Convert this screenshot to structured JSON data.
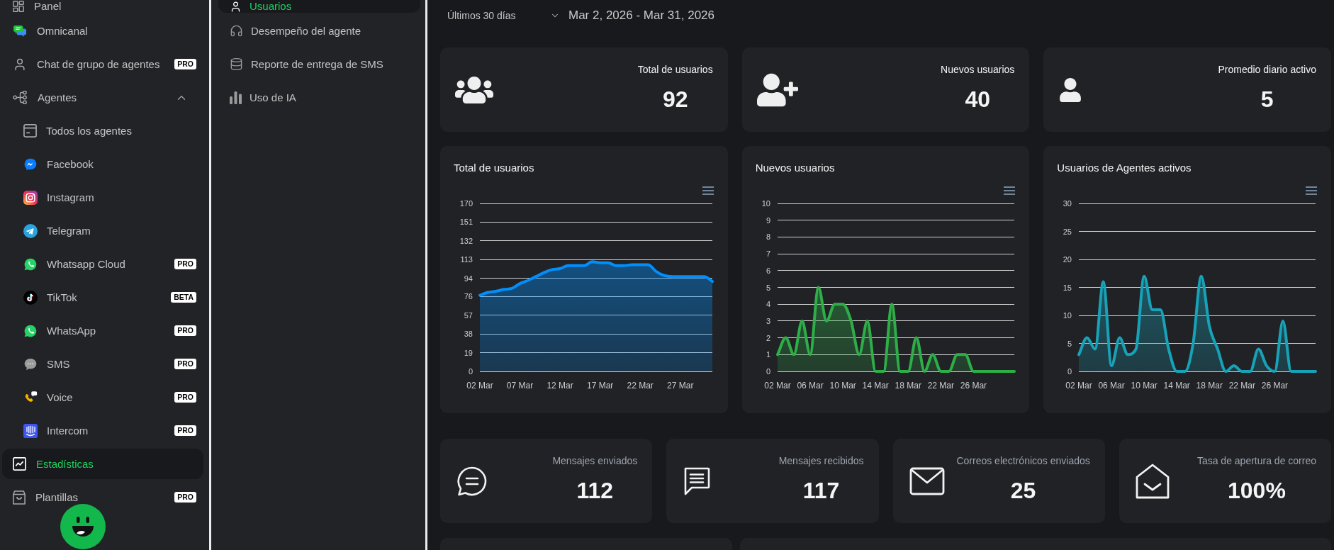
{
  "sidebar": {
    "items": [
      {
        "label": "Panel",
        "selected": false
      },
      {
        "label": "Omnicanal",
        "selected": false
      },
      {
        "label": "Chat de grupo de agentes",
        "badge": "PRO",
        "selected": false
      },
      {
        "label": "Agentes",
        "selected": false,
        "expanded": true,
        "children": [
          {
            "label": "Todos los agentes",
            "selected": false
          },
          {
            "label": "Facebook",
            "selected": false
          },
          {
            "label": "Instagram",
            "selected": false
          },
          {
            "label": "Telegram",
            "selected": false
          },
          {
            "label": "Whatsapp Cloud",
            "badge": "PRO",
            "selected": false
          },
          {
            "label": "TikTok",
            "badge": "BETA",
            "selected": false
          },
          {
            "label": "WhatsApp",
            "badge": "PRO",
            "selected": false
          },
          {
            "label": "SMS",
            "badge": "PRO",
            "selected": false
          },
          {
            "label": "Voice",
            "badge": "PRO",
            "selected": false
          },
          {
            "label": "Intercom",
            "badge": "PRO",
            "selected": false
          }
        ]
      },
      {
        "label": "Estadísticas",
        "selected": true
      },
      {
        "label": "Plantillas",
        "badge": "PRO",
        "selected": false
      }
    ]
  },
  "submenu": {
    "items": [
      {
        "label": "Usuarios",
        "selected": true
      },
      {
        "label": "Desempeño del agente",
        "selected": false
      },
      {
        "label": "Reporte de entrega de SMS",
        "selected": false
      },
      {
        "label": "Uso de IA",
        "selected": false
      }
    ]
  },
  "filter": {
    "range": "Últimos 30 días",
    "dates": "Mar 2, 2026 - Mar 31, 2026"
  },
  "summary_cards": [
    {
      "label": "Total de usuarios",
      "value": "92"
    },
    {
      "label": "Nuevos usuarios",
      "value": "40"
    },
    {
      "label": "Promedio diario activo",
      "value": "5"
    }
  ],
  "charts": [
    {
      "chart_data": {
        "type": "area",
        "title": "Total de usuarios",
        "categories": [
          "02 Mar",
          null,
          null,
          null,
          null,
          "07 Mar",
          null,
          null,
          null,
          null,
          "12 Mar",
          null,
          null,
          null,
          null,
          "17 Mar",
          null,
          null,
          null,
          null,
          "22 Mar",
          null,
          null,
          null,
          null,
          "27 Mar",
          null,
          null,
          null,
          null
        ],
        "series": [
          {
            "color": "#008ffb",
            "values": [
              77,
              80,
              81,
              83,
              84,
              89,
              92,
              96,
              100,
              103,
              104,
              107,
              107,
              107,
              111,
              110,
              110,
              107,
              107,
              108,
              108,
              108,
              101,
              97,
              96,
              96,
              96,
              96,
              96,
              91
            ]
          }
        ],
        "ylim": [
          0,
          170
        ],
        "yticks": [
          0,
          19,
          38,
          57,
          76,
          94,
          113,
          132,
          151,
          170
        ],
        "grid": true
      }
    },
    {
      "chart_data": {
        "type": "area",
        "title": "Nuevos usuarios",
        "categories": [
          "02 Mar",
          null,
          null,
          null,
          "06 Mar",
          null,
          null,
          null,
          "10 Mar",
          null,
          null,
          null,
          "14 Mar",
          null,
          null,
          null,
          "18 Mar",
          null,
          null,
          null,
          "22 Mar",
          null,
          null,
          null,
          "26 Mar",
          null,
          null,
          null,
          null,
          null
        ],
        "series": [
          {
            "color": "#2eae47",
            "values": [
              1,
              2,
              1,
              3,
              1,
              5,
              3,
              4,
              4,
              3,
              1,
              3,
              0,
              0,
              4,
              0,
              0,
              2,
              0,
              1,
              0,
              0,
              1,
              1,
              0,
              0,
              0,
              0,
              0,
              0
            ]
          }
        ],
        "ylim": [
          0,
          10
        ],
        "yticks": [
          0,
          1,
          2,
          3,
          4,
          5,
          6,
          7,
          8,
          9,
          10
        ],
        "grid": true
      }
    },
    {
      "chart_data": {
        "type": "area",
        "title": "Usuarios de Agentes activos",
        "categories": [
          "02 Mar",
          null,
          null,
          null,
          "06 Mar",
          null,
          null,
          null,
          "10 Mar",
          null,
          null,
          null,
          "14 Mar",
          null,
          null,
          null,
          "18 Mar",
          null,
          null,
          null,
          "22 Mar",
          null,
          null,
          null,
          "26 Mar",
          null,
          null,
          null,
          null,
          null
        ],
        "series": [
          {
            "color": "#17a2b8",
            "values": [
              3,
              6,
              4,
              16,
              1,
              6,
              3,
              4,
              17,
              11,
              11,
              4,
              0,
              0,
              5,
              17,
              8,
              4,
              0,
              1,
              0,
              0,
              4,
              1,
              0,
              9,
              0,
              0,
              0,
              0
            ]
          }
        ],
        "ylim": [
          0,
          30
        ],
        "yticks": [
          0,
          5,
          10,
          15,
          20,
          25,
          30
        ],
        "grid": true
      }
    }
  ],
  "message_cards": [
    {
      "label": "Mensajes enviados",
      "value": "112"
    },
    {
      "label": "Mensajes recibidos",
      "value": "117"
    },
    {
      "label": "Correos electrónicos enviados",
      "value": "25"
    },
    {
      "label": "Tasa de apertura de correo",
      "value": "100%"
    }
  ]
}
